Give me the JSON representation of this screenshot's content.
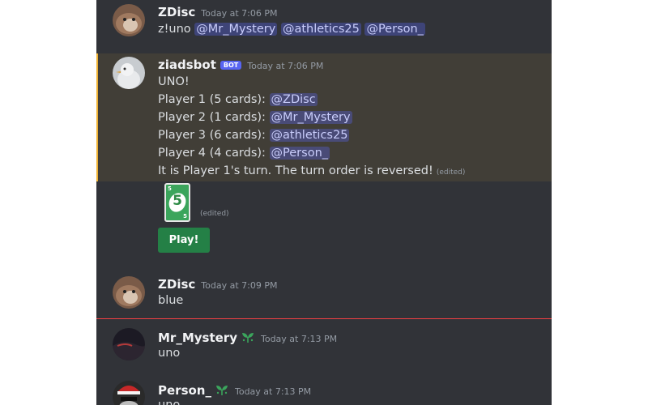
{
  "messages": [
    {
      "author": "ZDisc",
      "timestamp": "Today at 7:06 PM",
      "text_prefix": "z!uno ",
      "mentions": [
        "@Mr_Mystery",
        "@athletics25",
        "@Person_"
      ]
    },
    {
      "author": "ziadsbot",
      "badge": "BOT",
      "timestamp": "Today at 7:06 PM",
      "lines": [
        {
          "text": "UNO!"
        },
        {
          "text": "Player 1 (5 cards): ",
          "mention": "@ZDisc"
        },
        {
          "text": "Player 2 (1 cards): ",
          "mention": "@Mr_Mystery"
        },
        {
          "text": "Player 3 (6 cards): ",
          "mention": "@athletics25"
        },
        {
          "text": "Player 4 (4 cards): ",
          "mention": "@Person_"
        },
        {
          "text": "It is Player 1's turn. The turn order is reversed!",
          "edited": "(edited)"
        }
      ],
      "card": {
        "number": "5",
        "corner": "5",
        "color": "#3ba55c"
      },
      "card_edited": "(edited)",
      "button_label": "Play!"
    },
    {
      "author": "ZDisc",
      "timestamp": "Today at 7:09 PM",
      "text": "blue"
    },
    {
      "author": "Mr_Mystery",
      "timestamp": "Today at 7:13 PM",
      "text": "uno"
    },
    {
      "author": "Person_",
      "timestamp": "Today at 7:13 PM",
      "text": "uno"
    }
  ],
  "colors": {
    "background": "#313338",
    "highlight": "#413e37",
    "highlight_border": "#f0b232",
    "mention_bg": "#5865f2",
    "button": "#248046",
    "new_divider": "#f23f43"
  },
  "icons": {
    "role_icon": "sprout-icon"
  }
}
